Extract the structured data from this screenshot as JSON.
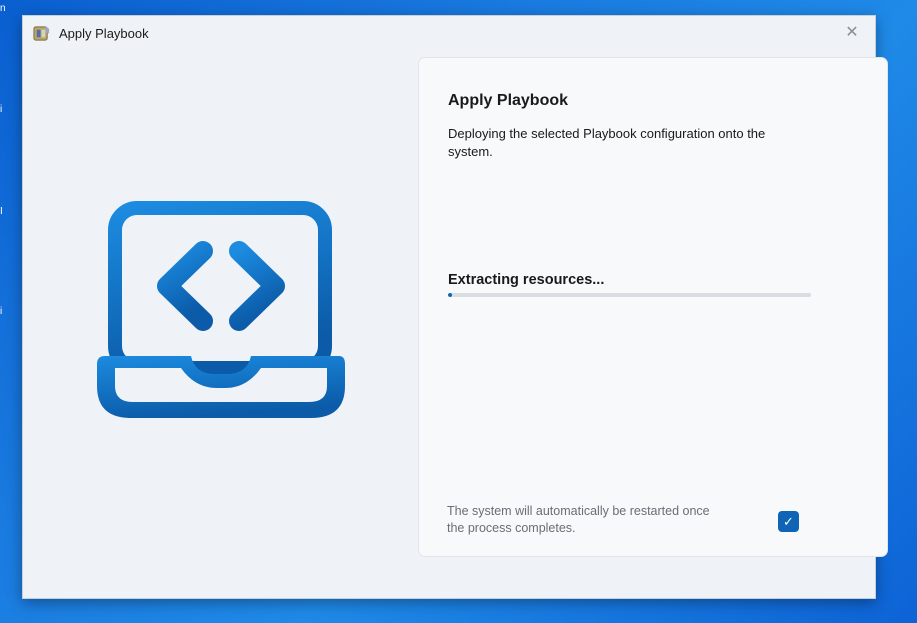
{
  "window": {
    "title": "Apply Playbook",
    "close_glyph": "✕"
  },
  "illustration": {
    "icon": "laptop-code-icon",
    "colors": [
      "#1c8be0",
      "#0b5ba8"
    ]
  },
  "panel": {
    "title": "Apply Playbook",
    "description": "Deploying the selected Playbook configuration onto the system.",
    "status": "Extracting resources...",
    "progress_fraction": 0.012,
    "restart_note": "The system will automatically be restarted once the process completes.",
    "restart_checked": true,
    "check_glyph": "✓"
  },
  "desktop": {
    "edge_glyphs": [
      "n",
      "i",
      "I",
      "i"
    ]
  },
  "colors": {
    "accent": "#0f64b5",
    "window_bg": "#eff3f7",
    "panel_bg": "#f7f9fb"
  }
}
